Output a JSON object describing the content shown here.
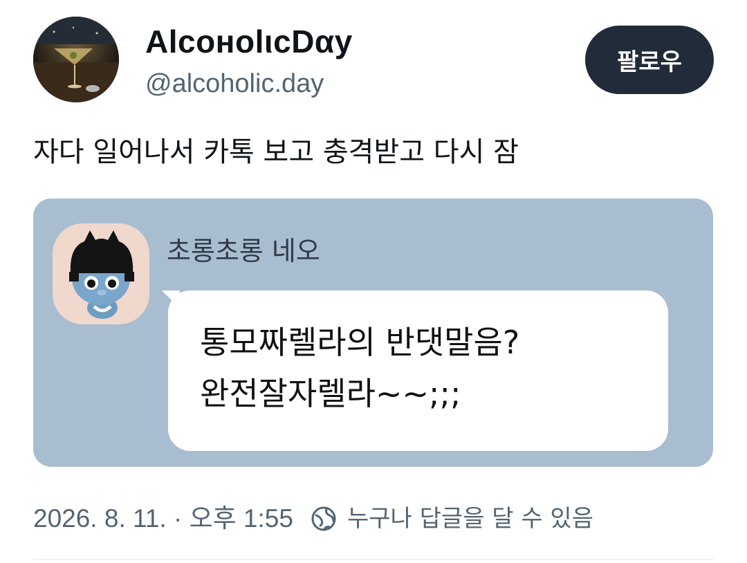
{
  "author": {
    "display_name": "AlcoнolιcDαy",
    "handle": "@alcoholic.day",
    "avatar_icon": "avatar-cocktail-glass"
  },
  "follow_button": {
    "label": "팔로우"
  },
  "tweet": {
    "text": "자다 일어나서 카톡 보고 충격받고 다시 잠"
  },
  "media": {
    "background_color": "#a9bdd1",
    "chat": {
      "sender_name": "초롱초롱 네오",
      "sender_avatar_icon": "kakao-neo-character",
      "message_lines": [
        "통모짜렐라의 반댓말음?",
        "완전잘자렐라~~;;;"
      ]
    }
  },
  "meta": {
    "timestamp": "2026. 8. 11. · 오후 1:55",
    "reply_icon": "globe-icon",
    "reply_setting": "누구나 답글을 달 수 있음"
  }
}
